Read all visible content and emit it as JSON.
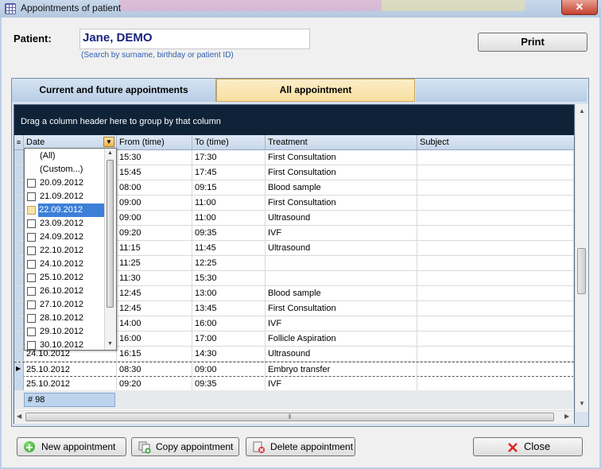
{
  "window": {
    "title": "Appointments of patient",
    "close_glyph": "✕"
  },
  "patient": {
    "label": "Patient:",
    "value": "Jane, DEMO",
    "hint": "(Search by surname, birthday or patient ID)"
  },
  "print_button": "Print",
  "tabs": [
    {
      "label": "Current and future appointments",
      "active": false
    },
    {
      "label": "All appointment",
      "active": true
    }
  ],
  "grid": {
    "group_hint": "Drag a column header here to group by that column",
    "columns": [
      "Date",
      "From (time)",
      "To (time)",
      "Treatment",
      "Subject"
    ],
    "rows": [
      {
        "date": "",
        "from": "15:30",
        "to": "17:30",
        "treatment": "First Consultation",
        "subject": ""
      },
      {
        "date": "",
        "from": "15:45",
        "to": "17:45",
        "treatment": "First Consultation",
        "subject": ""
      },
      {
        "date": "",
        "from": "08:00",
        "to": "09:15",
        "treatment": "Blood sample",
        "subject": ""
      },
      {
        "date": "",
        "from": "09:00",
        "to": "11:00",
        "treatment": "First Consultation",
        "subject": ""
      },
      {
        "date": "",
        "from": "09:00",
        "to": "11:00",
        "treatment": "Ultrasound",
        "subject": ""
      },
      {
        "date": "",
        "from": "09:20",
        "to": "09:35",
        "treatment": "IVF",
        "subject": ""
      },
      {
        "date": "",
        "from": "11:15",
        "to": "11:45",
        "treatment": "Ultrasound",
        "subject": ""
      },
      {
        "date": "",
        "from": "11:25",
        "to": "12:25",
        "treatment": "",
        "subject": ""
      },
      {
        "date": "",
        "from": "11:30",
        "to": "15:30",
        "treatment": "",
        "subject": ""
      },
      {
        "date": "",
        "from": "12:45",
        "to": "13:00",
        "treatment": "Blood sample",
        "subject": ""
      },
      {
        "date": "",
        "from": "12:45",
        "to": "13:45",
        "treatment": "First Consultation",
        "subject": ""
      },
      {
        "date": "",
        "from": "14:00",
        "to": "16:00",
        "treatment": "IVF",
        "subject": ""
      },
      {
        "date": "",
        "from": "16:00",
        "to": "17:00",
        "treatment": "Follicle Aspiration",
        "subject": ""
      },
      {
        "date": "24.10.2012",
        "from": "16:15",
        "to": "14:30",
        "treatment": "Ultrasound",
        "subject": ""
      },
      {
        "date": "25.10.2012",
        "from": "08:30",
        "to": "09:00",
        "treatment": "Embryo transfer",
        "subject": "",
        "current": true
      },
      {
        "date": "25.10.2012",
        "from": "09:20",
        "to": "09:35",
        "treatment": "IVF",
        "subject": ""
      }
    ],
    "footer_count": "# 98"
  },
  "date_filter": {
    "items": [
      {
        "label": "(All)",
        "checkbox": false
      },
      {
        "label": "(Custom...)",
        "checkbox": false
      },
      {
        "label": "20.09.2012",
        "checkbox": true
      },
      {
        "label": "21.09.2012",
        "checkbox": true
      },
      {
        "label": "22.09.2012",
        "checkbox": true,
        "highlighted": true
      },
      {
        "label": "23.09.2012",
        "checkbox": true
      },
      {
        "label": "24.09.2012",
        "checkbox": true
      },
      {
        "label": "22.10.2012",
        "checkbox": true
      },
      {
        "label": "24.10.2012",
        "checkbox": true
      },
      {
        "label": "25.10.2012",
        "checkbox": true
      },
      {
        "label": "26.10.2012",
        "checkbox": true
      },
      {
        "label": "27.10.2012",
        "checkbox": true
      },
      {
        "label": "28.10.2012",
        "checkbox": true
      },
      {
        "label": "29.10.2012",
        "checkbox": true
      },
      {
        "label": "30.10.2012",
        "checkbox": true
      }
    ]
  },
  "buttons": {
    "new_appointment": "New appointment",
    "copy_appointment": "Copy appointment",
    "delete_appointment": "Delete appointment",
    "close": "Close"
  },
  "icons": {
    "app": "calendar-grid-icon",
    "filter": "filter-dropdown-icon",
    "new": "plus-circle-icon",
    "copy": "copy-icon",
    "delete": "delete-icon",
    "close": "x-icon"
  },
  "colors": {
    "active_tab": "#f8dfa1",
    "group_panel": "#0e2338",
    "highlight": "#3c7fd8",
    "patient_name": "#1a237e"
  }
}
